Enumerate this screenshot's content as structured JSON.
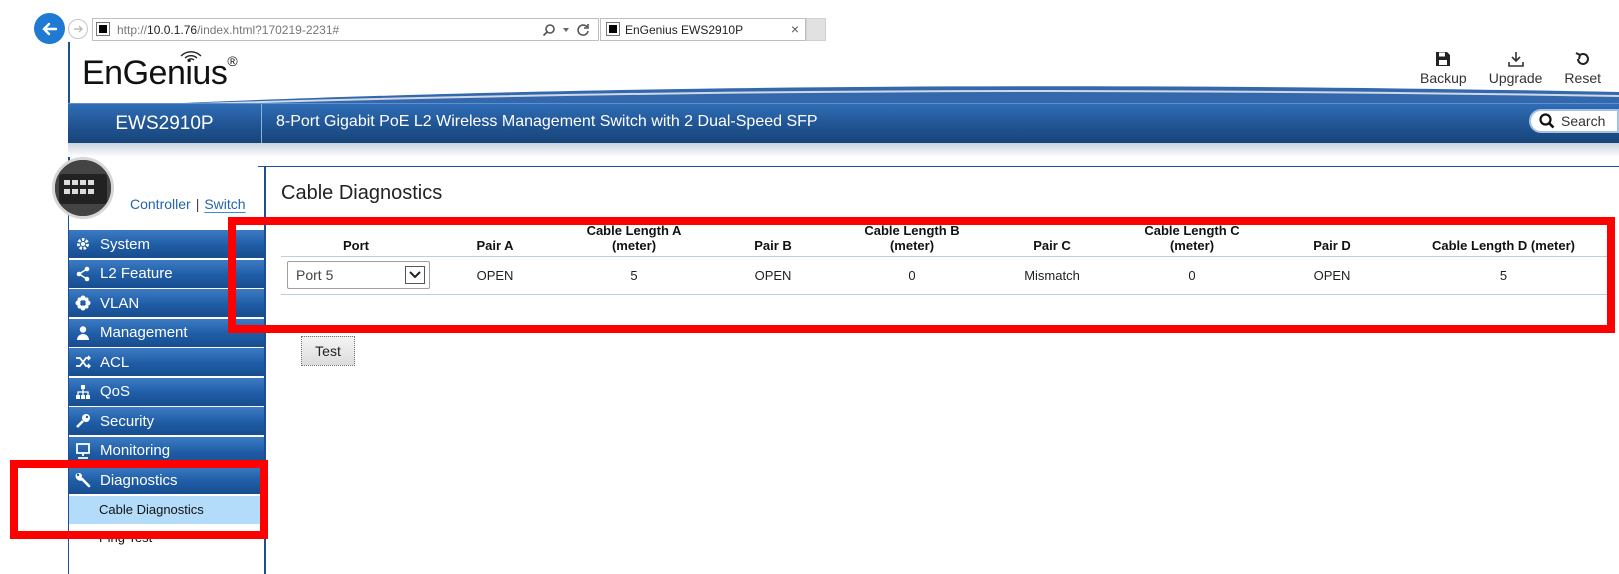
{
  "browser": {
    "url_prefix": "http://",
    "url_host": "10.0.1.76",
    "url_path": "/index.html?170219-2231#",
    "tab_title": "EnGenius EWS2910P",
    "tab_close": "×"
  },
  "header": {
    "logo": "EnGenius",
    "logo_mark": "®",
    "actions": [
      {
        "label": "Backup",
        "icon": "save-icon"
      },
      {
        "label": "Upgrade",
        "icon": "download-icon"
      },
      {
        "label": "Reset",
        "icon": "reset-icon"
      }
    ],
    "model": "EWS2910P",
    "model_description": "8-Port Gigabit PoE L2 Wireless Management Switch with 2 Dual-Speed SFP",
    "search_label": "Search"
  },
  "sidebar": {
    "toggle": {
      "controller": "Controller",
      "separator": "|",
      "switch": "Switch"
    },
    "items": [
      {
        "label": "System",
        "icon": "gear-icon"
      },
      {
        "label": "L2 Feature",
        "icon": "share-icon"
      },
      {
        "label": "VLAN",
        "icon": "flower-icon"
      },
      {
        "label": "Management",
        "icon": "user-icon"
      },
      {
        "label": "ACL",
        "icon": "shuffle-icon"
      },
      {
        "label": "QoS",
        "icon": "sitemap-icon"
      },
      {
        "label": "Security",
        "icon": "key-icon"
      },
      {
        "label": "Monitoring",
        "icon": "monitor-icon"
      },
      {
        "label": "Diagnostics",
        "icon": "wrench-icon"
      }
    ],
    "sub_active": "Cable Diagnostics",
    "sub_next": "Ping Test"
  },
  "main": {
    "title": "Cable Diagnostics",
    "columns": [
      [
        "Port"
      ],
      [
        "Pair A"
      ],
      [
        "Cable Length A",
        "(meter)"
      ],
      [
        "Pair B"
      ],
      [
        "Cable Length B",
        "(meter)"
      ],
      [
        "Pair C"
      ],
      [
        "Cable Length C",
        "(meter)"
      ],
      [
        "Pair D"
      ],
      [
        "Cable Length D (meter)"
      ]
    ],
    "row": {
      "port": "Port 5",
      "values": [
        "OPEN",
        "5",
        "OPEN",
        "0",
        "Mismatch",
        "0",
        "OPEN",
        "5"
      ]
    },
    "test_button": "Test"
  },
  "colors": {
    "accent": "#1f5ca6",
    "highlight": "#ff0000",
    "submenu_active": "#b3dcfb"
  }
}
